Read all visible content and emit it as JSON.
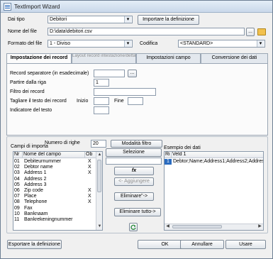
{
  "window": {
    "title": "TextImport Wizard"
  },
  "top": {
    "dai_tipo_label": "Dai tipo",
    "dai_tipo_value": "Debitori",
    "import_button": "Importare la definizione",
    "nome_file_label": "Nome del file",
    "nome_file_value": "D:\\data\\debitori.csv",
    "browse_button": "...",
    "formato_label": "Formato del file",
    "formato_value": "1 - Diviso",
    "codifica_label": "Codifica",
    "codifica_value": "<STANDARD>"
  },
  "tabs": [
    {
      "label": "Impostazione dei record"
    },
    {
      "label": "Layout record intestazione/dettaglio"
    },
    {
      "label": "Impostazioni campo"
    },
    {
      "label": "Conversione dei dati"
    }
  ],
  "record": {
    "separator_label": "Record separatore (in esadecimale)",
    "separator_value": "",
    "separator_button": "...",
    "start_row_label": "Partire dalla riga",
    "start_row_value": "1",
    "filter_label": "Filtro dei record",
    "filter_value": "",
    "cut_label": "Tagliare il testo dei record",
    "cut_start_label": "Inizio",
    "cut_start_value": "",
    "cut_end_label": "Fine",
    "cut_end_value": "",
    "text_indicator_label": "Indicatore del testo",
    "text_indicator_value": ""
  },
  "fields_section": {
    "campi_label": "Campi di importa",
    "numero_label": "Numero di righe",
    "numero_value": "20",
    "modalita_button": "Modalità filtro",
    "selezione_button": "Selezione",
    "fx_button": "fx",
    "aggiungere_button": "<- Aggiungere",
    "eliminare_button": "Eliminare\"->",
    "eliminare_tutto_button": "Eliminare tutto->",
    "esempio_label": "Esempio dei dati",
    "columns": [
      "Nr",
      "Nome del campo",
      "Ob"
    ],
    "rows": [
      {
        "nr": "01",
        "name": "Debiteurnummer",
        "ob": "X"
      },
      {
        "nr": "02",
        "name": "Debtor name",
        "ob": "X"
      },
      {
        "nr": "03",
        "name": "Address 1",
        "ob": "X"
      },
      {
        "nr": "04",
        "name": "Address 2",
        "ob": ""
      },
      {
        "nr": "05",
        "name": "Address 3",
        "ob": ""
      },
      {
        "nr": "06",
        "name": "Zip code",
        "ob": "X"
      },
      {
        "nr": "07",
        "name": "Place",
        "ob": "X"
      },
      {
        "nr": "08",
        "name": "Telephone",
        "ob": "X"
      },
      {
        "nr": "09",
        "name": "Fax",
        "ob": ""
      },
      {
        "nr": "10",
        "name": "Banknaam",
        "ob": ""
      },
      {
        "nr": "11",
        "name": "Bankrekeningnummer",
        "ob": ""
      }
    ],
    "sample_columns": [
      "Ri",
      "Veld 1"
    ],
    "sample_rows": [
      {
        "ri": "1",
        "veld": "Debtor;Name;Address1;Address2;Address3"
      }
    ]
  },
  "footer": {
    "export_button": "Esportare la definizione",
    "ok_button": "OK",
    "annullare_button": "Annullare",
    "usare_button": "Usare"
  },
  "icons": {
    "window": "list-icon",
    "folder": "folder-icon",
    "fx": "function-icon",
    "refresh": "refresh-icon"
  },
  "colors": {
    "title_bar": "#c9d8ea",
    "accent": "#2a6bbf",
    "folder": "#f2c14e"
  }
}
